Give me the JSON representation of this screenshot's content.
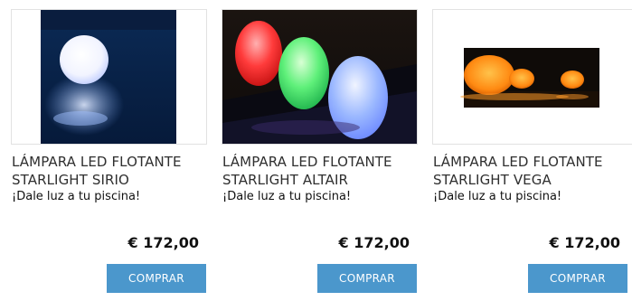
{
  "products": [
    {
      "title_line1": "LÁMPARA LED FLOTANTE",
      "title_line2": "STARLIGHT SIRIO",
      "tagline": "¡Dale luz a tu piscina!",
      "price": "€ 172,00",
      "buy_label": "COMPRAR"
    },
    {
      "title_line1": "LÁMPARA LED FLOTANTE",
      "title_line2": "STARLIGHT ALTAIR",
      "tagline": "¡Dale luz a tu piscina!",
      "price": "€ 172,00",
      "buy_label": "COMPRAR"
    },
    {
      "title_line1": "LÁMPARA LED FLOTANTE",
      "title_line2": "STARLIGHT VEGA",
      "tagline": "¡Dale luz a tu piscina!",
      "price": "€ 172,00",
      "buy_label": "COMPRAR"
    }
  ],
  "colors": {
    "button": "#4b97cc",
    "border": "#e2e2e2"
  }
}
